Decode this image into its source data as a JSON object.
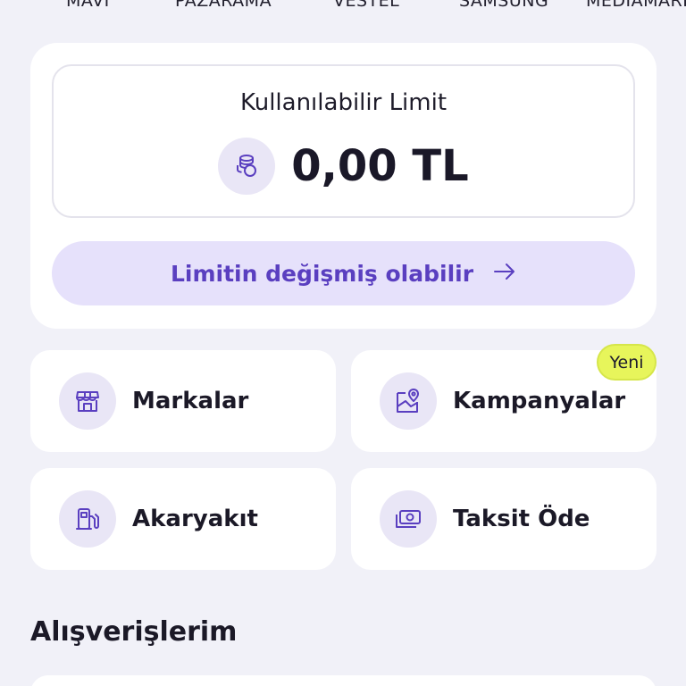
{
  "brands": [
    "MAVİ",
    "PAZARAMA",
    "VESTEL",
    "SAMSUNG",
    "MEDIAMARKT"
  ],
  "limit": {
    "title": "Kullanılabilir Limit",
    "amount": "0,00 TL",
    "change_label": "Limitin değişmiş olabilir"
  },
  "tiles": [
    {
      "label": "Markalar",
      "icon": "store-icon"
    },
    {
      "label": "Kampanyalar",
      "icon": "map-pin-icon",
      "badge": "Yeni"
    },
    {
      "label": "Akaryakıt",
      "icon": "fuel-pump-icon"
    },
    {
      "label": "Taksit Öde",
      "icon": "cash-icon"
    }
  ],
  "section": {
    "title": "Alışverişlerim"
  },
  "colors": {
    "accent": "#5a3fc0",
    "accent_soft": "#e6e1fb",
    "badge": "#e7f55b",
    "background": "#f1f1f8"
  }
}
